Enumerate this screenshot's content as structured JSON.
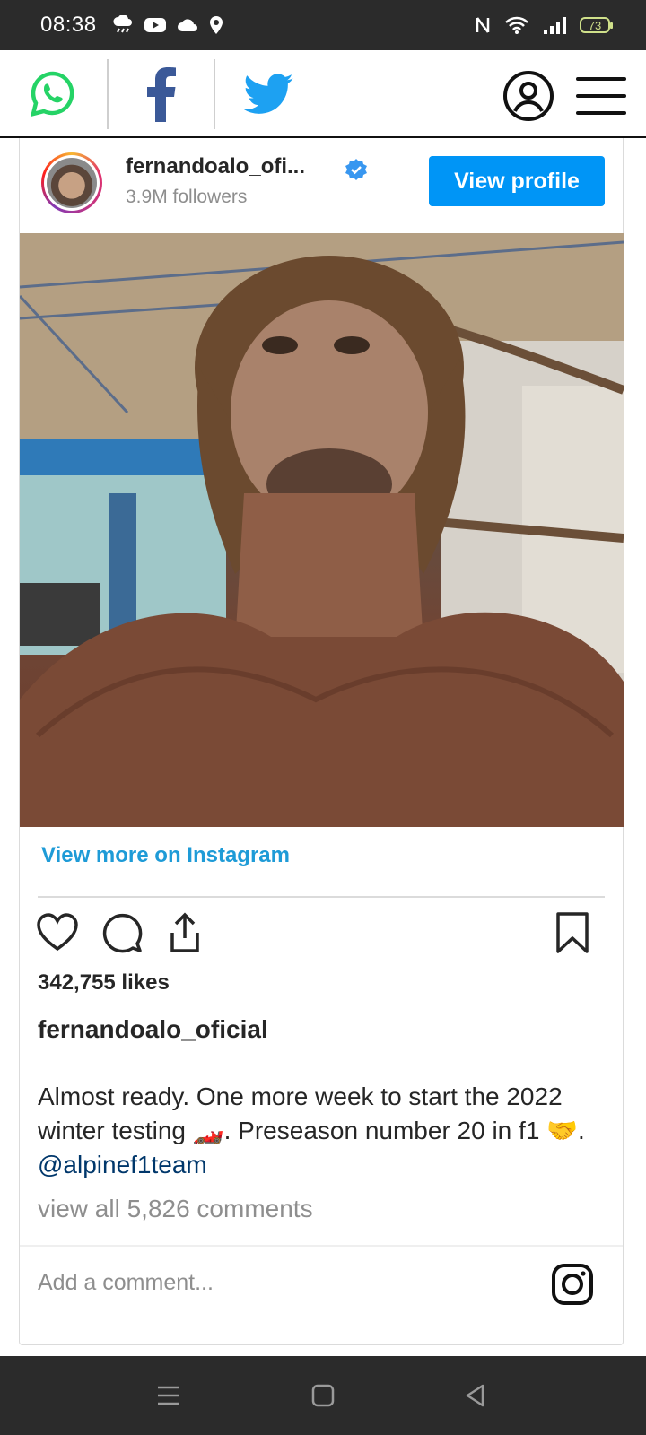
{
  "status_bar": {
    "time": "08:38",
    "battery": "73",
    "icons": [
      "rain-cloud-icon",
      "youtube-icon",
      "cloud-icon",
      "location-icon",
      "nfc-icon",
      "wifi-icon",
      "signal-icon",
      "battery-icon"
    ]
  },
  "share_bar": {
    "buttons": [
      "whatsapp-icon",
      "facebook-icon",
      "twitter-icon",
      "account-icon",
      "menu-icon"
    ],
    "colors": {
      "whatsapp": "#25d366",
      "facebook": "#3b5998",
      "twitter": "#1da1f2"
    }
  },
  "post": {
    "username_short": "fernandoalo_ofi...",
    "followers": "3.9M followers",
    "view_profile_label": "View profile",
    "view_more_label": "View more on Instagram",
    "likes": "342,755 likes",
    "username": "fernandoalo_oficial",
    "caption_part1": "Almost ready. One more week to start the 2022 winter testing ",
    "caption_emoji1": "🏎️",
    "caption_part2": ". Preseason number 20 in f1 ",
    "caption_emoji2": "🤝",
    "caption_part3": ". ",
    "mention": "@alpinef1team",
    "comments_link": "view all 5,826 comments",
    "add_comment_placeholder": "Add a comment..."
  },
  "colors": {
    "accent": "#0095f6",
    "link": "#1e9bd7"
  }
}
